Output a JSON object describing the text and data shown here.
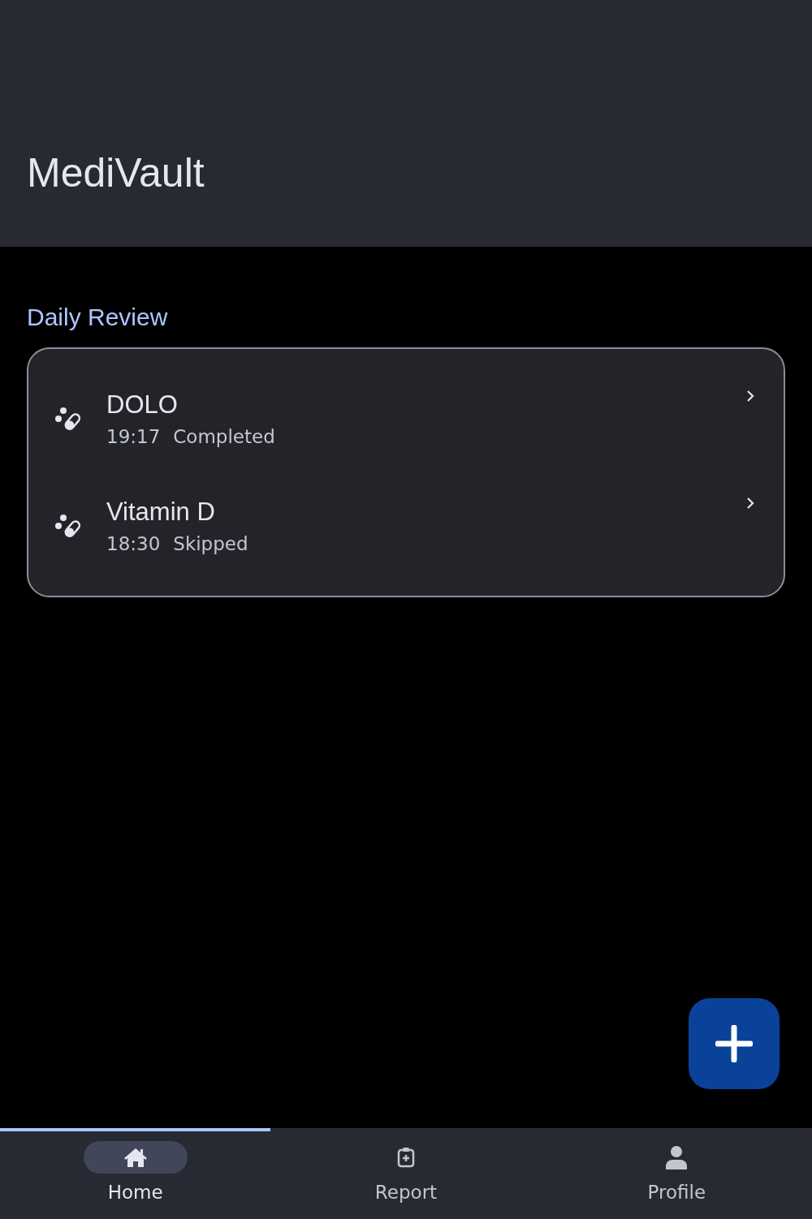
{
  "app_bar": {
    "title": "MediVault"
  },
  "section": {
    "title": "Daily Review"
  },
  "medications": [
    {
      "name": "DOLO",
      "time": "19:17",
      "status": "Completed"
    },
    {
      "name": "Vitamin D",
      "time": "18:30",
      "status": "Skipped"
    }
  ],
  "nav": [
    {
      "label": "Home",
      "selected": true
    },
    {
      "label": "Report",
      "selected": false
    },
    {
      "label": "Profile",
      "selected": false
    }
  ]
}
